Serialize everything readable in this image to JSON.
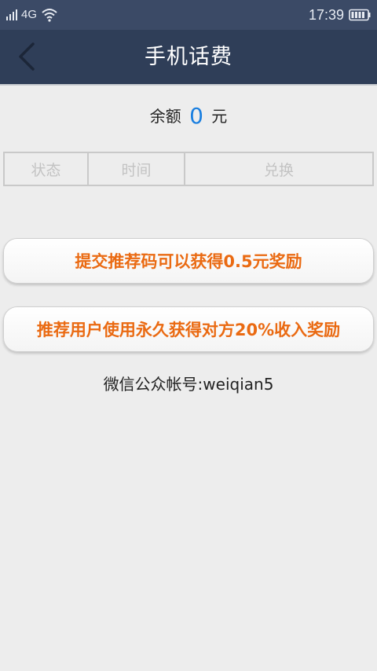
{
  "status_bar": {
    "network": "4G",
    "time": "17:39",
    "colors": {
      "background": "#3b4a66",
      "text": "#e8ecf3"
    }
  },
  "header": {
    "title": "手机话费",
    "background": "#2f3e58"
  },
  "balance": {
    "label": "余额",
    "value": "0",
    "unit": "元",
    "value_color": "#1a7fe0"
  },
  "table": {
    "columns": [
      "状态",
      "时间",
      "兑换"
    ]
  },
  "buttons": {
    "submit_code": "提交推荐码可以获得0.5元奖励",
    "refer_user": "推荐用户使用永久获得对方20%收入奖励",
    "text_color": "#ea6a12"
  },
  "footer": {
    "wechat": "微信公众帐号:weiqian5"
  },
  "icons": {
    "signal": "signal-icon",
    "wifi": "wifi-icon",
    "battery": "battery-icon",
    "back": "chevron-left-icon"
  }
}
